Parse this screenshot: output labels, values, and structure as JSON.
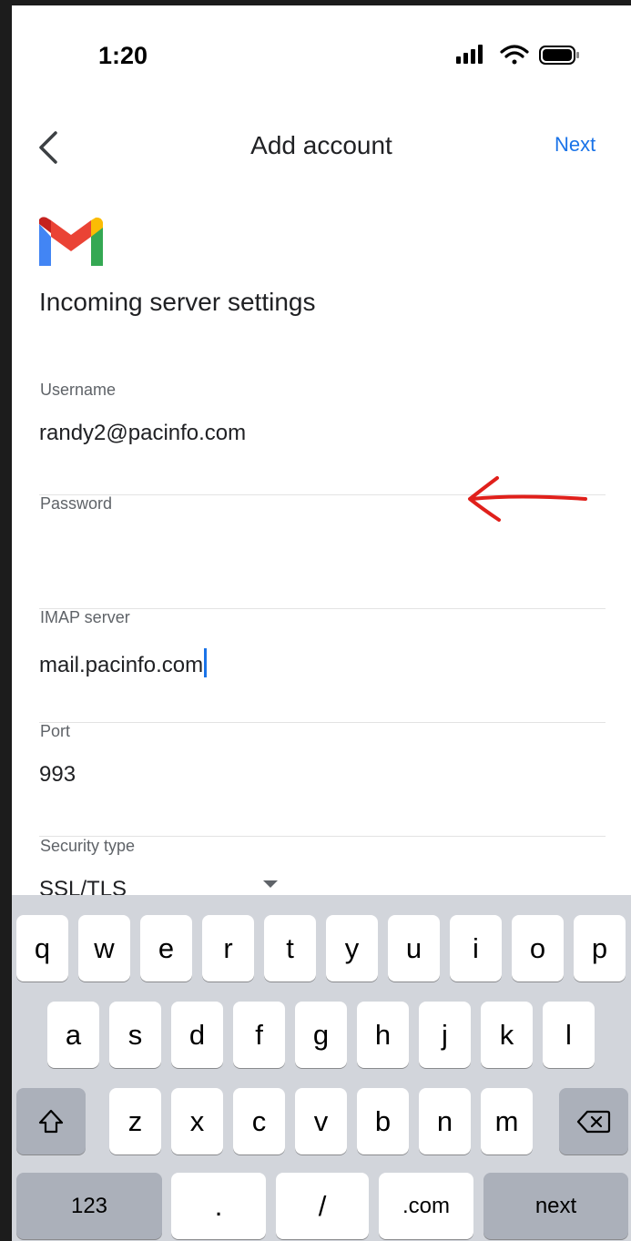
{
  "status_bar": {
    "time": "1:20"
  },
  "nav": {
    "title": "Add account",
    "next_label": "Next"
  },
  "section_title": "Incoming server settings",
  "fields": {
    "username": {
      "label": "Username",
      "value": "randy2@pacinfo.com"
    },
    "password": {
      "label": "Password",
      "value": ""
    },
    "imap_server": {
      "label": "IMAP server",
      "value": "mail.pacinfo.com"
    },
    "port": {
      "label": "Port",
      "value": "993"
    },
    "security_type": {
      "label": "Security type",
      "value": "SSL/TLS"
    }
  },
  "annotation": {
    "color": "#e0201b"
  },
  "keyboard": {
    "row1": [
      "q",
      "w",
      "e",
      "r",
      "t",
      "y",
      "u",
      "i",
      "o",
      "p"
    ],
    "row2": [
      "a",
      "s",
      "d",
      "f",
      "g",
      "h",
      "j",
      "k",
      "l"
    ],
    "row3": [
      "z",
      "x",
      "c",
      "v",
      "b",
      "n",
      "m"
    ],
    "bottom": {
      "numbers": "123",
      "dot": ".",
      "slash": "/",
      "com": ".com",
      "next": "next"
    }
  },
  "colors": {
    "accent": "#1a73e8",
    "keyboard_bg": "#d2d5db"
  }
}
